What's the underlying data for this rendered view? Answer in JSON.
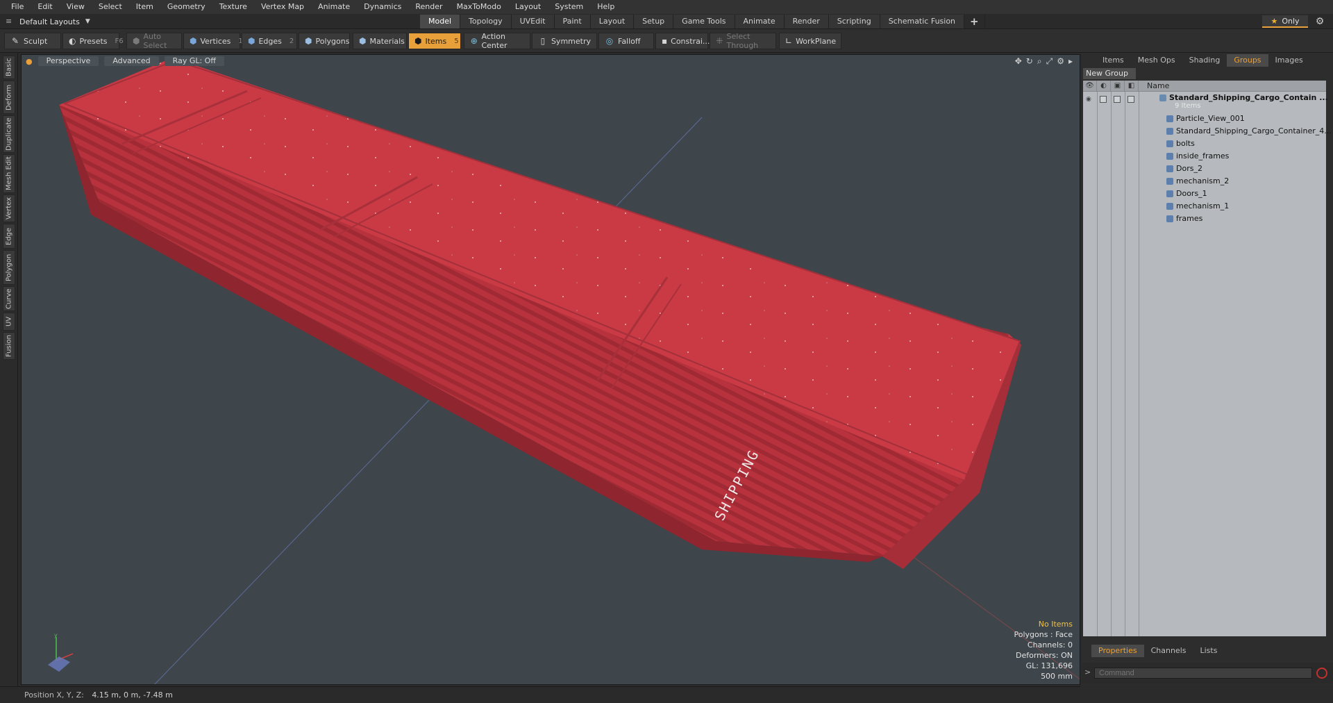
{
  "menu": [
    "File",
    "Edit",
    "View",
    "Select",
    "Item",
    "Geometry",
    "Texture",
    "Vertex Map",
    "Animate",
    "Dynamics",
    "Render",
    "MaxToModo",
    "Layout",
    "System",
    "Help"
  ],
  "layouts_label": "Default Layouts",
  "mode_tabs": [
    "Model",
    "Topology",
    "UVEdit",
    "Paint",
    "Layout",
    "Setup",
    "Game Tools",
    "Animate",
    "Render",
    "Scripting",
    "Schematic Fusion"
  ],
  "active_mode_tab": "Model",
  "only_label": "Only",
  "toolbar": {
    "sculpt": "Sculpt",
    "presets": "Presets",
    "presets_key": "F6",
    "auto_select": "Auto Select",
    "vertices": "Vertices",
    "vertices_count": "1",
    "edges": "Edges",
    "edges_count": "2",
    "polygons": "Polygons",
    "materials": "Materials",
    "items": "Items",
    "items_count": "5",
    "action_center": "Action Center",
    "symmetry": "Symmetry",
    "falloff": "Falloff",
    "constrain": "Constrai...",
    "select_through": "Select Through",
    "workplane": "WorkPlane"
  },
  "left_tabs": [
    "Basic",
    "Deform",
    "Duplicate",
    "Mesh Edit",
    "Vertex",
    "Edge",
    "Polygon",
    "Curve",
    "UV",
    "Fusion"
  ],
  "viewport": {
    "view_mode": "Perspective",
    "shading": "Advanced",
    "raygl": "Ray GL: Off",
    "hud": {
      "selection": "No Items",
      "polygons": "Polygons : Face",
      "channels": "Channels: 0",
      "deformers": "Deformers: ON",
      "gl": "GL: 131,696",
      "scale": "500 mm"
    },
    "container_text": "SHIPPING"
  },
  "right_panel": {
    "tabs": [
      "Items",
      "Mesh Ops",
      "Shading",
      "Groups",
      "Images"
    ],
    "active_tab": "Groups",
    "new_group": "New Group",
    "name_header": "Name",
    "root": {
      "label": "Standard_Shipping_Cargo_Contain ...",
      "sub": "9 Items"
    },
    "children": [
      "Particle_View_001",
      "Standard_Shipping_Cargo_Container_4...",
      "bolts",
      "inside_frames",
      "Dors_2",
      "mechanism_2",
      "Doors_1",
      "mechanism_1",
      "frames"
    ],
    "bottom_tabs": [
      "Properties",
      "Channels",
      "Lists"
    ],
    "active_bottom_tab": "Properties",
    "command_placeholder": "Command"
  },
  "status": {
    "label": "Position X, Y, Z:",
    "value": "4.15 m, 0 m, -7.48 m"
  },
  "colors": {
    "accent": "#e8a03a",
    "container_red": "#c93a45",
    "viewport_bg": "#3f464b"
  }
}
